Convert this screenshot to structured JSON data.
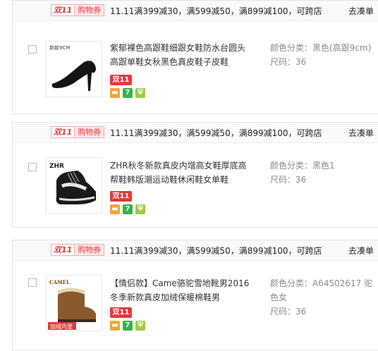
{
  "stores": [
    {
      "coupon_logo": "双11",
      "coupon_label": "购物券",
      "promo_text": "11.11满399减30，满599减50，满899减100，可跨店",
      "go_link": "去凑单",
      "item": {
        "thumb_brand": "新款9CM",
        "title": "紫郁裸色高跟鞋细跟女鞋防水台圆头高跟单鞋女秋黑色真皮鞋子皮鞋",
        "tag": "双11",
        "attr_color": "颜色分类：黑色(高跟9cm)",
        "attr_size": "尺码：36"
      }
    },
    {
      "coupon_logo": "双11",
      "coupon_label": "购物券",
      "promo_text": "11.11满399减30，满599减50，满899减100，可跨店",
      "go_link": "去凑单",
      "item": {
        "thumb_brand": "ZHR",
        "title": "ZHR秋冬新款真皮内增高女鞋厚底高帮鞋韩版潮运动鞋休闲鞋女单鞋",
        "tag": "双11",
        "attr_color": "颜色分类：黑色1",
        "attr_size": "尺码：36"
      }
    },
    {
      "coupon_logo": "双11",
      "coupon_label": "购物券",
      "promo_text": "11.11满399减30，满599减50，满899减100，可跨店",
      "go_link": "去凑单",
      "item": {
        "thumb_brand": "CAMEL",
        "thumb_badge": "加绒内里",
        "title": "【情侣款】Came骆驼雪地靴男2016冬季新款真皮加绒保暖棉鞋男",
        "tag": "双11",
        "attr_color": "颜色分类：A64502617 驼色女",
        "attr_size": "尺码：36"
      }
    }
  ],
  "icons": [
    "card-icon",
    "seven-day-return-icon",
    "shield-icon"
  ],
  "colors": {
    "accent": "#e4393c",
    "muted": "#8a8a8a",
    "orange": "#f1a536",
    "green": "#35b34a",
    "lime": "#9ccd3f"
  }
}
